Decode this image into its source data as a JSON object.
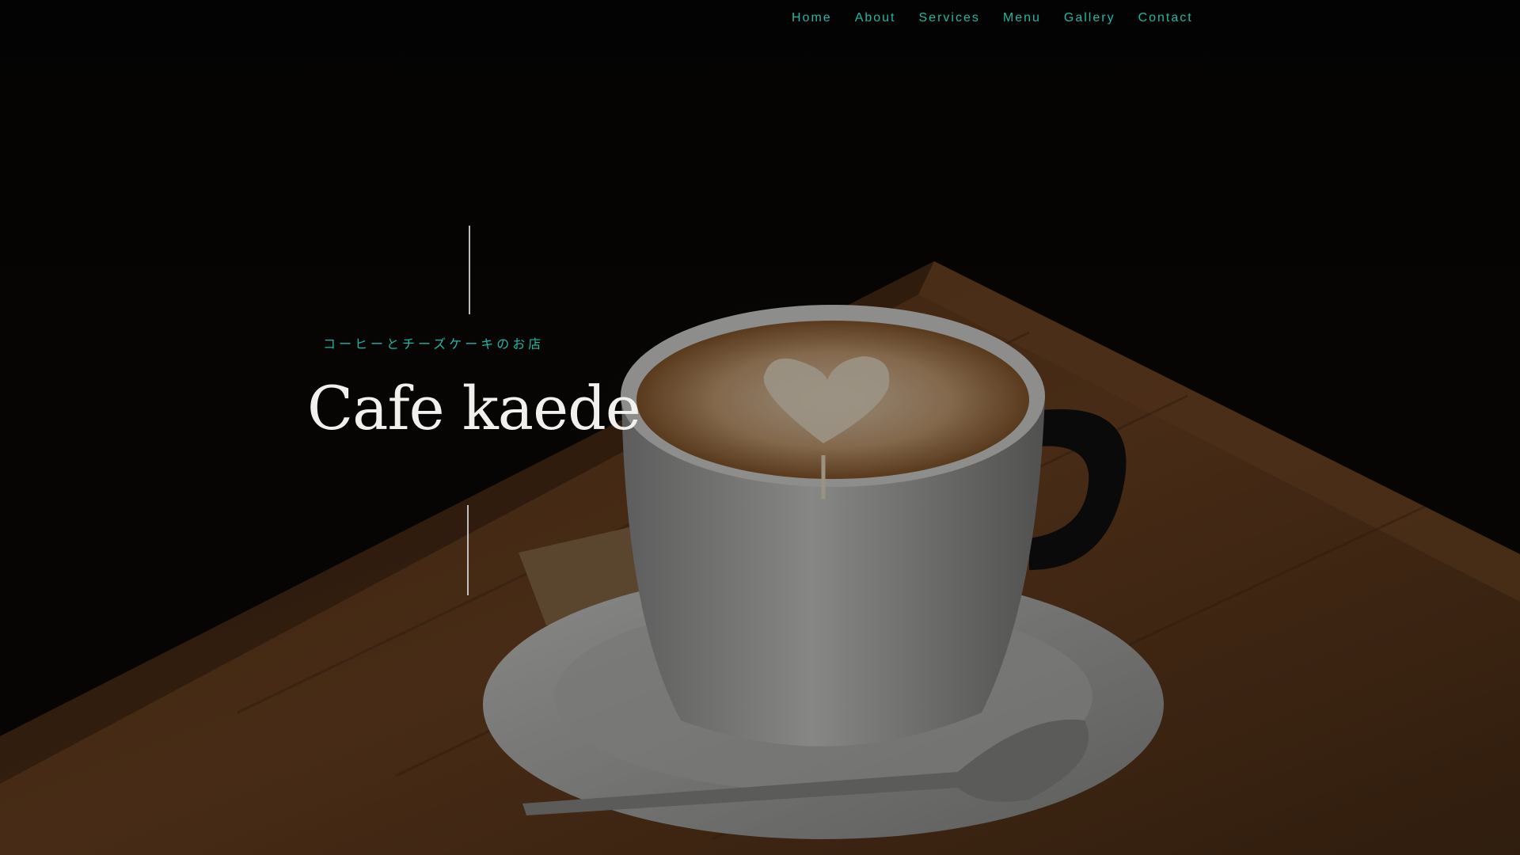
{
  "nav": {
    "items": [
      "Home",
      "About",
      "Services",
      "Menu",
      "Gallery",
      "Contact"
    ],
    "color": "#1fb8a2"
  },
  "hero": {
    "tagline": "コーヒーとチーズケーキのお店",
    "title": "Cafe kaede",
    "photo_icon": "coffee-cup-photo"
  },
  "colors": {
    "accent": "#1fb8a2",
    "title_text": "#f2f0ec",
    "background": "#050403"
  }
}
